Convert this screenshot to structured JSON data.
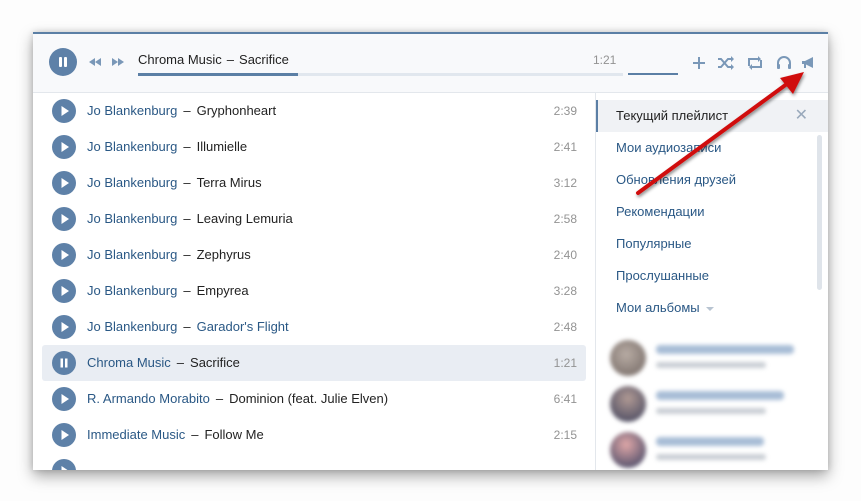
{
  "player": {
    "artist": "Chroma Music",
    "separator": "–",
    "title": "Sacrifice",
    "time": "1:21",
    "progress_fraction": 0.33,
    "volume_fraction": 1.0,
    "controls": [
      "add-icon",
      "shuffle-icon",
      "repeat-icon",
      "headphones-icon",
      "broadcast-icon"
    ]
  },
  "tracks": [
    {
      "artist": "Jo Blankenburg",
      "title": "Gryphonheart",
      "duration": "2:39",
      "active": false,
      "title_link": false
    },
    {
      "artist": "Jo Blankenburg",
      "title": "Illumielle",
      "duration": "2:41",
      "active": false,
      "title_link": false
    },
    {
      "artist": "Jo Blankenburg",
      "title": "Terra Mirus",
      "duration": "3:12",
      "active": false,
      "title_link": false
    },
    {
      "artist": "Jo Blankenburg",
      "title": "Leaving Lemuria",
      "duration": "2:58",
      "active": false,
      "title_link": false
    },
    {
      "artist": "Jo Blankenburg",
      "title": "Zephyrus",
      "duration": "2:40",
      "active": false,
      "title_link": false
    },
    {
      "artist": "Jo Blankenburg",
      "title": "Empyrea",
      "duration": "3:28",
      "active": false,
      "title_link": false
    },
    {
      "artist": "Jo Blankenburg",
      "title": "Garador's Flight",
      "duration": "2:48",
      "active": false,
      "title_link": true
    },
    {
      "artist": "Chroma Music",
      "title": "Sacrifice",
      "duration": "1:21",
      "active": true,
      "title_link": false
    },
    {
      "artist": "R. Armando Morabito",
      "title": "Dominion (feat. Julie Elven)",
      "duration": "6:41",
      "active": false,
      "title_link": false
    },
    {
      "artist": "Immediate Music",
      "title": "Follow Me",
      "duration": "2:15",
      "active": false,
      "title_link": false
    }
  ],
  "sidebar": {
    "current": "Текущий плейлист",
    "close": "✕",
    "items": [
      "Мои аудиозаписи",
      "Обновления друзей",
      "Рекомендации",
      "Популярные",
      "Прослушанные",
      "Мои альбомы"
    ],
    "friends_blurred": 3
  },
  "annotation": {
    "type": "red-arrow",
    "points_to": "broadcast-icon",
    "color": "#d01010"
  },
  "colors": {
    "accent": "#5b7fa5",
    "link": "#2a5885",
    "active_row": "#e9edf3"
  }
}
